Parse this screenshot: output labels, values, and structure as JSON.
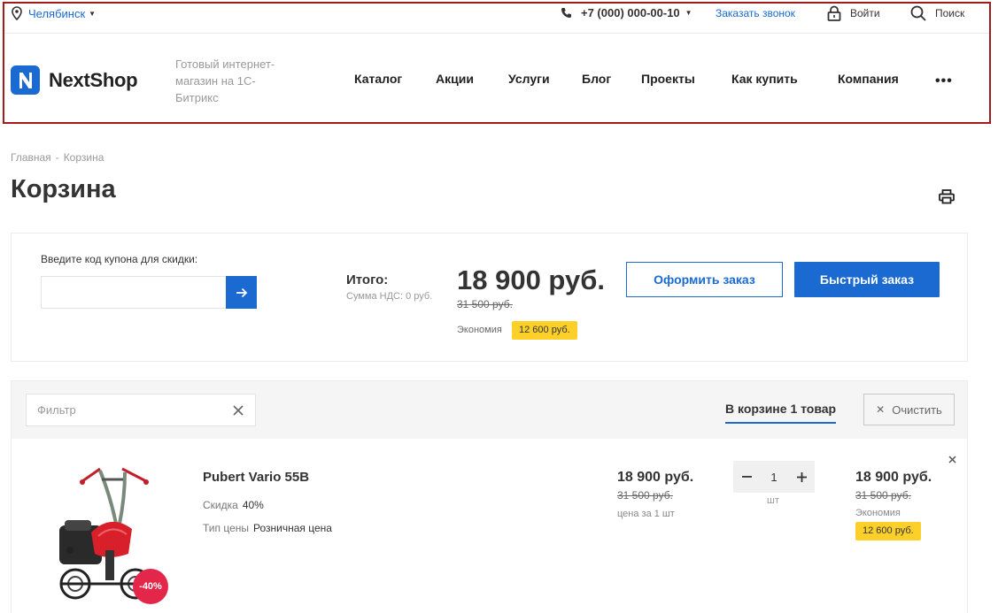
{
  "header": {
    "city": "Челябинск",
    "phone": "+7 (000) 000-00-10",
    "callback": "Заказать звонок",
    "login": "Войти",
    "search": "Поиск",
    "logo_text": "NextShop",
    "tagline": "Готовый интернет-магазин на 1С-Битрикс",
    "nav": [
      "Каталог",
      "Акции",
      "Услуги",
      "Блог",
      "Проекты",
      "Как купить",
      "Компания"
    ],
    "nav_more": "•••",
    "frame_color": "#a31a1a"
  },
  "breadcrumb": [
    "Главная",
    "Корзина"
  ],
  "breadcrumb_sep": "-",
  "page_title": "Корзина",
  "summary": {
    "coupon_label": "Введите код купона для скидки:",
    "coupon_value": "",
    "total_label": "Итого:",
    "vat": "Сумма НДС: 0 руб.",
    "total": "18 900 руб.",
    "total_old": "31 500 руб.",
    "economy_label": "Экономия",
    "economy": "12 600 руб.",
    "checkout": "Оформить заказ",
    "quick_order": "Быстрый заказ"
  },
  "basket": {
    "filter_placeholder": "Фильтр",
    "tab_count": "В корзине 1 товар",
    "clear": "Очистить",
    "items": [
      {
        "name": "Pubert Vario 55B",
        "discount": "-40%",
        "props": [
          {
            "label": "Скидка",
            "value": "40%"
          },
          {
            "label": "Тип цены",
            "value": "Розничная цена"
          }
        ],
        "unit_price": "18 900 руб.",
        "unit_old": "31 500 руб.",
        "unit_note": "цена за 1 шт",
        "qty": "1",
        "qty_unit": "шт",
        "sum": "18 900 руб.",
        "sum_old": "31 500 руб.",
        "sum_economy_label": "Экономия",
        "sum_economy": "12 600 руб."
      }
    ]
  },
  "colors": {
    "accent": "#1a6ad2",
    "economy_badge": "#fcd028",
    "discount_badge": "#e3264a"
  },
  "icons": [
    "location-pin-icon",
    "phone-icon",
    "lock-icon",
    "search-icon",
    "logo-n-icon",
    "print-icon",
    "arrow-right-icon",
    "close-icon",
    "minus-icon",
    "plus-icon"
  ]
}
